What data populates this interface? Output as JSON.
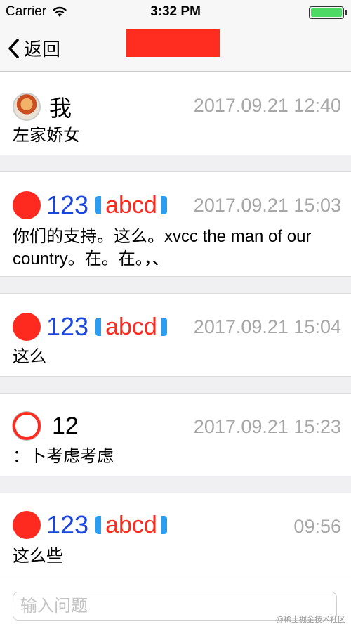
{
  "status_bar": {
    "carrier": "Carrier",
    "time": "3:32 PM"
  },
  "nav": {
    "back_label": "返回"
  },
  "messages": [
    {
      "name": "我",
      "time": "2017.09.21 12:40",
      "content": "左家娇女"
    },
    {
      "name": "123",
      "tag": "abcd",
      "time": "2017.09.21 15:03",
      "content": "你们的支持。这么。xvcc the man of our country。在。在。，、"
    },
    {
      "name": "123",
      "tag": "abcd",
      "time": "2017.09.21 15:04",
      "content": "这么"
    },
    {
      "name": "12",
      "time": "2017.09.21 15:23",
      "content": "：卜考虑考虑"
    },
    {
      "name": "123",
      "tag": "abcd",
      "time": "09:56",
      "content": "这么些"
    }
  ],
  "input": {
    "placeholder": "输入问题"
  },
  "watermark": "@稀土掘金技术社区",
  "colors": {
    "accent_red": "#ff2a1f",
    "name_blue": "#1a46e0",
    "bracket_blue": "#2a9ef2",
    "time_gray": "#a7a7a7"
  }
}
